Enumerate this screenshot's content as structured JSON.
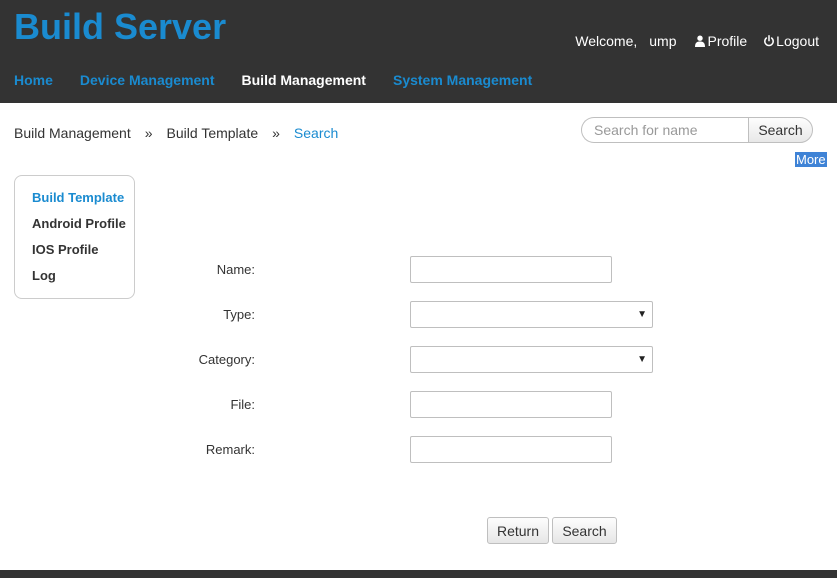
{
  "header": {
    "app_title": "Build Server",
    "welcome": "Welcome,",
    "username": "ump",
    "profile_label": "Profile",
    "logout_label": "Logout"
  },
  "nav": {
    "items": [
      {
        "label": "Home",
        "active": false
      },
      {
        "label": "Device Management",
        "active": false
      },
      {
        "label": "Build Management",
        "active": true
      },
      {
        "label": "System Management",
        "active": false
      }
    ]
  },
  "breadcrumb": {
    "items": [
      "Build Management",
      "Build Template",
      "Search"
    ],
    "separator": "»"
  },
  "search": {
    "placeholder": "Search for name",
    "button_label": "Search",
    "more_label": "More"
  },
  "sidebar": {
    "items": [
      {
        "label": "Build Template",
        "active": true
      },
      {
        "label": "Android Profile",
        "active": false
      },
      {
        "label": "IOS Profile",
        "active": false
      },
      {
        "label": "Log",
        "active": false
      }
    ]
  },
  "form": {
    "name_label": "Name:",
    "name_value": "",
    "type_label": "Type:",
    "type_value": "",
    "category_label": "Category:",
    "category_value": "",
    "file_label": "File:",
    "file_value": "",
    "remark_label": "Remark:",
    "remark_value": "",
    "return_label": "Return",
    "search_label": "Search"
  },
  "colors": {
    "accent": "#1a8bd0",
    "header_bg": "#333333",
    "more_bg": "#3f83d6"
  },
  "icons": {
    "profile": "user-icon",
    "logout": "power-icon",
    "select_arrow": "triangle-down-icon"
  }
}
